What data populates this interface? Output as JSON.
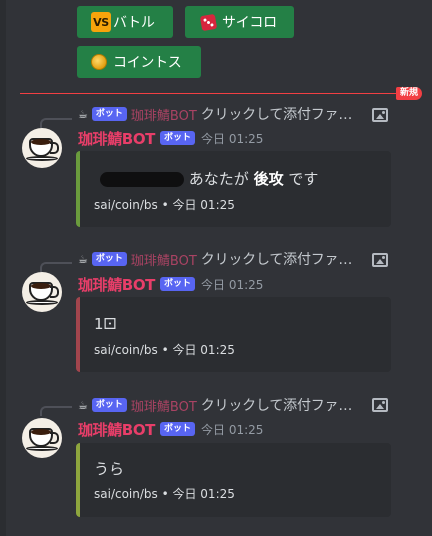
{
  "buttons": {
    "battle": {
      "icon": "vs-icon",
      "badge": "VS",
      "label": "バトル"
    },
    "dice": {
      "icon": "dice-icon",
      "label": "サイコロ"
    },
    "coin": {
      "icon": "coin-icon",
      "label": "コイントス"
    }
  },
  "divider": {
    "label": "新規",
    "color": "#f23f43"
  },
  "bot_tag": "ボット",
  "author": "珈琲鯖BOT",
  "reply_text": "クリックして添付ファ…",
  "timestamp": "今日 01:25",
  "messages": [
    {
      "text_before": "あなたが",
      "text_bold": "後攻",
      "text_after": "です",
      "footer": "sai/coin/bs • 今日 01:25",
      "embed_color": "#6a9b3d"
    },
    {
      "text": "1⚀",
      "footer": "sai/coin/bs • 今日 01:25",
      "embed_color": "#a2454d"
    },
    {
      "text": "うら",
      "footer": "sai/coin/bs • 今日 01:25",
      "embed_color": "#8ea63e"
    }
  ],
  "colors": {
    "background": "#313338",
    "button": "#248046",
    "author": "#e83e69",
    "bot_tag": "#5865f2"
  }
}
